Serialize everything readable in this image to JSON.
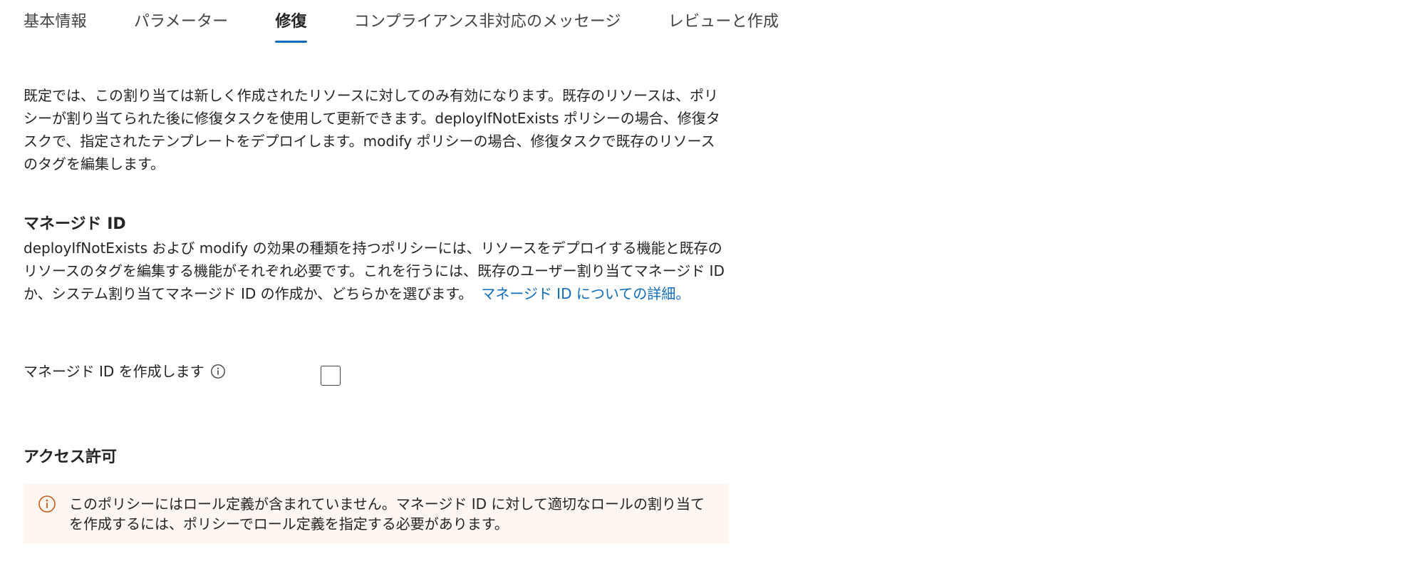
{
  "tabs": [
    {
      "label": "基本情報",
      "active": false
    },
    {
      "label": "パラメーター",
      "active": false
    },
    {
      "label": "修復",
      "active": true
    },
    {
      "label": "コンプライアンス非対応のメッセージ",
      "active": false
    },
    {
      "label": "レビューと作成",
      "active": false
    }
  ],
  "intro": {
    "text": "既定では、この割り当ては新しく作成されたリソースに対してのみ有効になります。既存のリソースは、ポリシーが割り当てられた後に修復タスクを使用して更新できます。deployIfNotExists ポリシーの場合、修復タスクで、指定されたテンプレートをデプロイします。modify ポリシーの場合、修復タスクで既存のリソースのタグを編集します。"
  },
  "managed_identity": {
    "heading": "マネージド ID",
    "description": "deployIfNotExists および modify の効果の種類を持つポリシーには、リソースをデプロイする機能と既存のリソースのタグを編集する機能がそれぞれ必要です。これを行うには、既存のユーザー割り当てマネージド ID か、システム割り当てマネージド ID の作成か、どちらかを選びます。",
    "link": "マネージド ID についての詳細。",
    "create_label": "マネージド ID を作成します",
    "create_checked": false
  },
  "access": {
    "heading": "アクセス許可",
    "warning": "このポリシーにはロール定義が含まれていません。マネージド ID に対して適切なロールの割り当てを作成するには、ポリシーでロール定義を指定する必要があります。"
  },
  "icons": {
    "info": "info-icon",
    "warning": "warning-info-icon"
  },
  "colors": {
    "accent": "#0f6cbd",
    "warning_icon": "#c85b11",
    "warning_bg": "#fdf6f1"
  }
}
